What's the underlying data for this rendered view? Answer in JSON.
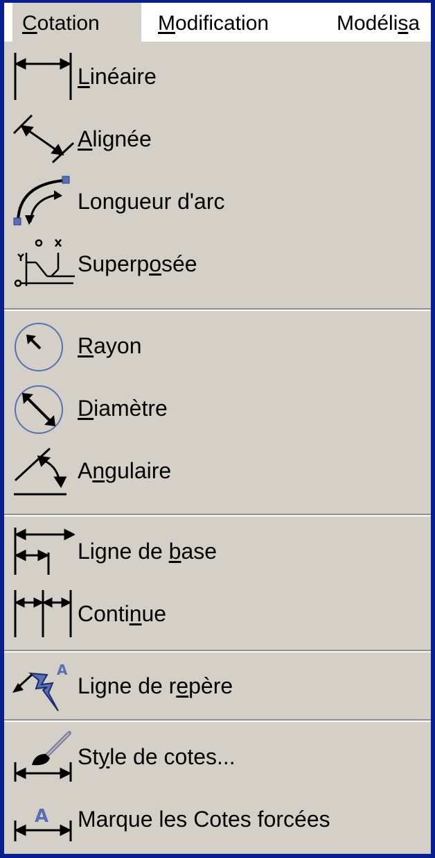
{
  "menubar": {
    "items": [
      {
        "pre": "",
        "u": "C",
        "post": "otation"
      },
      {
        "pre": "",
        "u": "M",
        "post": "odification"
      },
      {
        "pre": "Modéli",
        "u": "s",
        "post": "a"
      }
    ]
  },
  "menu": {
    "items": [
      {
        "pre": "",
        "u": "L",
        "post": "inéaire",
        "icon": "linear-dimension-icon"
      },
      {
        "pre": "",
        "u": "A",
        "post": "lignée",
        "icon": "aligned-dimension-icon"
      },
      {
        "pre": "Lon",
        "u": "g",
        "post": "ueur d'arc",
        "icon": "arc-length-icon"
      },
      {
        "pre": "Superp",
        "u": "o",
        "post": "sée",
        "icon": "ordinate-dimension-icon"
      },
      {
        "pre": "",
        "u": "R",
        "post": "ayon",
        "icon": "radius-dimension-icon"
      },
      {
        "pre": "",
        "u": "D",
        "post": "iamètre",
        "icon": "diameter-dimension-icon"
      },
      {
        "pre": "A",
        "u": "n",
        "post": "gulaire",
        "icon": "angular-dimension-icon"
      },
      {
        "pre": "Ligne de ",
        "u": "b",
        "post": "ase",
        "icon": "baseline-dimension-icon"
      },
      {
        "pre": "Conti",
        "u": "n",
        "post": "ue",
        "icon": "continue-dimension-icon"
      },
      {
        "pre": "Ligne de r",
        "u": "e",
        "post": "père",
        "icon": "leader-icon"
      },
      {
        "pre": "St",
        "u": "y",
        "post": "le de cotes...",
        "icon": "dimension-style-icon"
      },
      {
        "pre": "Marque les Cotes forcées",
        "u": "",
        "post": "",
        "icon": "override-dimension-icon"
      }
    ]
  },
  "colors": {
    "frame": "#0a1f8f",
    "menu_bg": "#d4d0c8",
    "menubar_bg": "#ffffff",
    "icon_blue": "#5a6fb3"
  }
}
